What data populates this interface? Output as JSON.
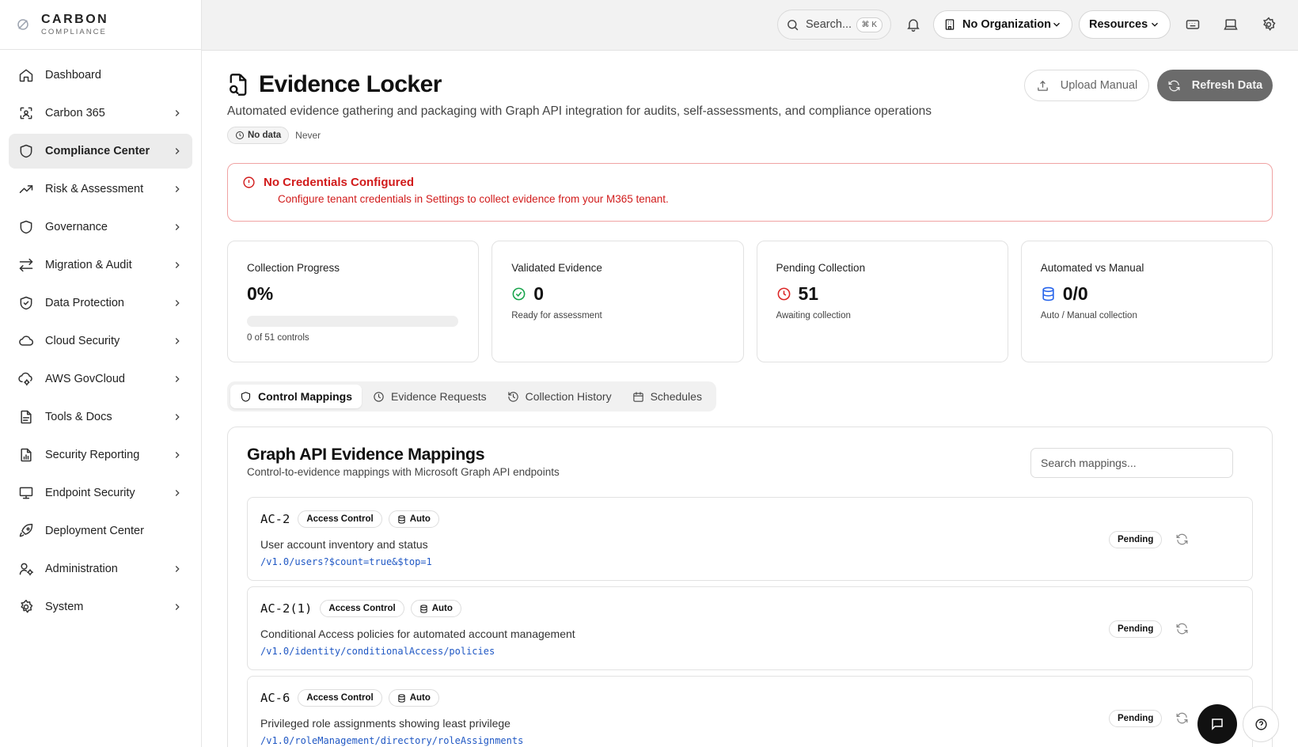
{
  "brand": {
    "name": "CARBON",
    "sub": "COMPLIANCE"
  },
  "sidebar": {
    "items": [
      {
        "label": "Dashboard",
        "icon": "home-icon",
        "chevron": false,
        "active": false
      },
      {
        "label": "Carbon 365",
        "icon": "scan-icon",
        "chevron": true,
        "active": false
      },
      {
        "label": "Compliance Center",
        "icon": "shield-icon",
        "chevron": true,
        "active": true
      },
      {
        "label": "Risk & Assessment",
        "icon": "trending-up-icon",
        "chevron": true,
        "active": false
      },
      {
        "label": "Governance",
        "icon": "shield-icon",
        "chevron": true,
        "active": false
      },
      {
        "label": "Migration & Audit",
        "icon": "arrows-icon",
        "chevron": true,
        "active": false
      },
      {
        "label": "Data Protection",
        "icon": "shield-check-icon",
        "chevron": true,
        "active": false
      },
      {
        "label": "Cloud Security",
        "icon": "cloud-icon",
        "chevron": true,
        "active": false
      },
      {
        "label": "AWS GovCloud",
        "icon": "cloud-cog-icon",
        "chevron": true,
        "active": false
      },
      {
        "label": "Tools & Docs",
        "icon": "file-text-icon",
        "chevron": true,
        "active": false
      },
      {
        "label": "Security Reporting",
        "icon": "file-chart-icon",
        "chevron": true,
        "active": false
      },
      {
        "label": "Endpoint Security",
        "icon": "monitor-icon",
        "chevron": true,
        "active": false
      },
      {
        "label": "Deployment Center",
        "icon": "rocket-icon",
        "chevron": false,
        "active": false
      },
      {
        "label": "Administration",
        "icon": "user-cog-icon",
        "chevron": true,
        "active": false
      },
      {
        "label": "System",
        "icon": "gear-icon",
        "chevron": true,
        "active": false
      }
    ]
  },
  "topbar": {
    "search_label": "Search...",
    "search_shortcut": "⌘ K",
    "org_label": "No Organization",
    "resources_label": "Resources"
  },
  "page": {
    "title": "Evidence Locker",
    "subtitle": "Automated evidence gathering and packaging with Graph API integration for audits, self-assessments, and compliance operations",
    "status_badge": "No data",
    "last_updated": "Never",
    "upload_label": "Upload Manual",
    "refresh_label": "Refresh Data"
  },
  "alert": {
    "title": "No Credentials Configured",
    "description": "Configure tenant credentials in Settings to collect evidence from your M365 tenant."
  },
  "stats": {
    "collection": {
      "label": "Collection Progress",
      "value": "0%",
      "progress": 0,
      "sub": "0 of 51 controls"
    },
    "validated": {
      "label": "Validated Evidence",
      "value": "0",
      "sub": "Ready for assessment"
    },
    "pending": {
      "label": "Pending Collection",
      "value": "51",
      "sub": "Awaiting collection"
    },
    "automated": {
      "label": "Automated vs Manual",
      "value": "0/0",
      "sub": "Auto / Manual collection"
    }
  },
  "tabs": [
    {
      "label": "Control Mappings",
      "active": true
    },
    {
      "label": "Evidence Requests",
      "active": false
    },
    {
      "label": "Collection History",
      "active": false
    },
    {
      "label": "Schedules",
      "active": false
    }
  ],
  "panel": {
    "title": "Graph API Evidence Mappings",
    "description": "Control-to-evidence mappings with Microsoft Graph API endpoints",
    "search_placeholder": "Search mappings...",
    "mappings": [
      {
        "id": "AC-2",
        "family": "Access Control",
        "mode": "Auto",
        "description": "User account inventory and status",
        "endpoint": "/v1.0/users?$count=true&$top=1",
        "status": "Pending"
      },
      {
        "id": "AC-2(1)",
        "family": "Access Control",
        "mode": "Auto",
        "description": "Conditional Access policies for automated account management",
        "endpoint": "/v1.0/identity/conditionalAccess/policies",
        "status": "Pending"
      },
      {
        "id": "AC-6",
        "family": "Access Control",
        "mode": "Auto",
        "description": "Privileged role assignments showing least privilege",
        "endpoint": "/v1.0/roleManagement/directory/roleAssignments",
        "status": "Pending"
      }
    ]
  },
  "colors": {
    "alert": "#d11b1b",
    "validated_icon": "#16a34a",
    "pending_icon": "#dc2626",
    "automated_icon": "#2563eb",
    "endpoint": "#2058c4"
  }
}
